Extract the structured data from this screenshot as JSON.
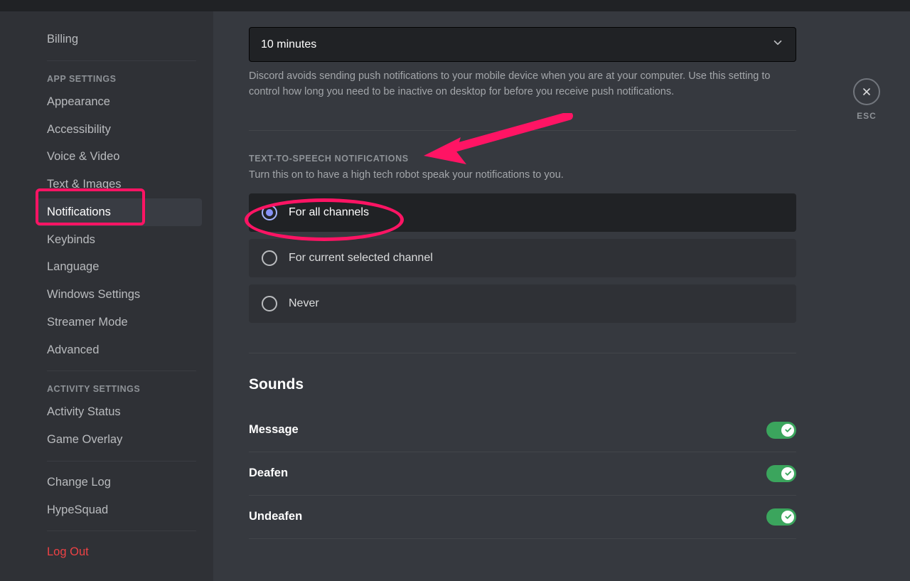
{
  "sidebar": {
    "items": [
      {
        "label": "Billing",
        "type": "item"
      },
      {
        "type": "sep"
      },
      {
        "label": "APP SETTINGS",
        "type": "category"
      },
      {
        "label": "Appearance",
        "type": "item"
      },
      {
        "label": "Accessibility",
        "type": "item"
      },
      {
        "label": "Voice & Video",
        "type": "item"
      },
      {
        "label": "Text & Images",
        "type": "item"
      },
      {
        "label": "Notifications",
        "type": "item",
        "active": true
      },
      {
        "label": "Keybinds",
        "type": "item"
      },
      {
        "label": "Language",
        "type": "item"
      },
      {
        "label": "Windows Settings",
        "type": "item"
      },
      {
        "label": "Streamer Mode",
        "type": "item"
      },
      {
        "label": "Advanced",
        "type": "item"
      },
      {
        "type": "sep"
      },
      {
        "label": "ACTIVITY SETTINGS",
        "type": "category"
      },
      {
        "label": "Activity Status",
        "type": "item"
      },
      {
        "label": "Game Overlay",
        "type": "item"
      },
      {
        "type": "sep"
      },
      {
        "label": "Change Log",
        "type": "item"
      },
      {
        "label": "HypeSquad",
        "type": "item"
      },
      {
        "type": "sep"
      },
      {
        "label": "Log Out",
        "type": "item",
        "logout": true
      }
    ]
  },
  "close_label": "ESC",
  "push_timeout": {
    "selected": "10 minutes",
    "helper": "Discord avoids sending push notifications to your mobile device when you are at your computer. Use this setting to control how long you need to be inactive on desktop for before you receive push notifications."
  },
  "tts": {
    "heading": "TEXT-TO-SPEECH NOTIFICATIONS",
    "helper": "Turn this on to have a high tech robot speak your notifications to you.",
    "options": [
      {
        "label": "For all channels",
        "selected": true
      },
      {
        "label": "For current selected channel",
        "selected": false
      },
      {
        "label": "Never",
        "selected": false
      }
    ]
  },
  "sounds": {
    "heading": "Sounds",
    "items": [
      {
        "label": "Message",
        "on": true
      },
      {
        "label": "Deafen",
        "on": true
      },
      {
        "label": "Undeafen",
        "on": true
      }
    ]
  }
}
